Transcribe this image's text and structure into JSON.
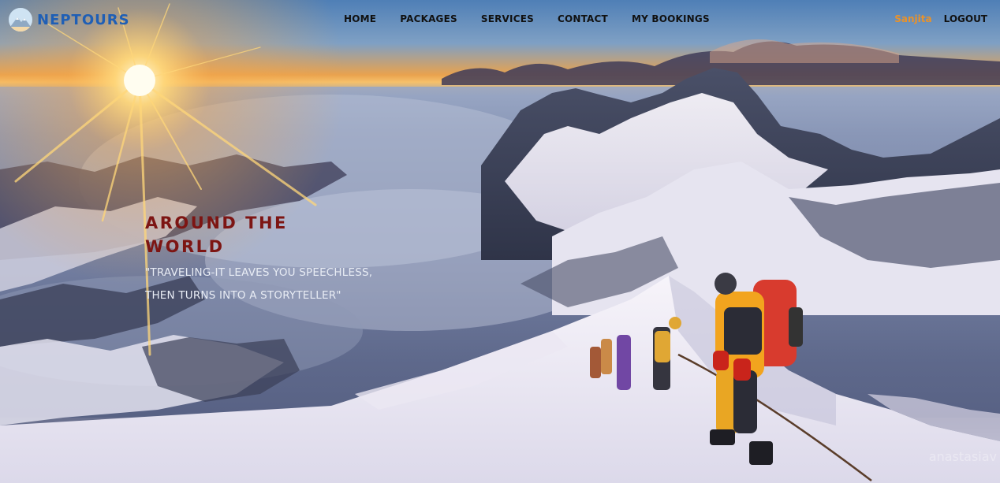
{
  "brand": {
    "name": "NEPTOURS",
    "logo_icon": "mountain-logo-icon"
  },
  "nav": {
    "items": [
      {
        "label": "HOME"
      },
      {
        "label": "PACKAGES"
      },
      {
        "label": "SERVICES"
      },
      {
        "label": "CONTACT"
      },
      {
        "label": "MY BOOKINGS"
      }
    ],
    "user_name": "Sanjita",
    "logout_label": "LOGOUT"
  },
  "hero": {
    "headline_line1": "AROUND THE",
    "headline_line2": "WORLD",
    "quote_line1": "\"TRAVELING-IT LEAVES YOU SPEECHLESS,",
    "quote_line2": "THEN TURNS INTO A STORYTELLER\"",
    "watermark": "anastasiav"
  },
  "colors": {
    "brand_blue": "#1f5fb5",
    "user_orange": "#e8922b",
    "headline_red": "#7d1513",
    "nav_text": "#111111"
  }
}
